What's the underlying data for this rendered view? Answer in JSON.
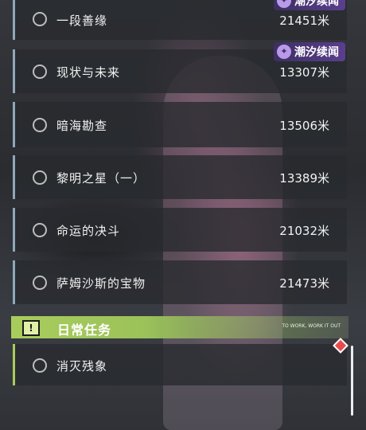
{
  "quests": [
    {
      "name": "一段善缘",
      "distance": "21451米",
      "badge": "潮汐续闻"
    },
    {
      "name": "现状与未来",
      "distance": "13307米",
      "badge": "潮汐续闻"
    },
    {
      "name": "暗海勘查",
      "distance": "13506米"
    },
    {
      "name": "黎明之星（一）",
      "distance": "13389米"
    },
    {
      "name": "命运的决斗",
      "distance": "21032米"
    },
    {
      "name": "萨姆沙斯的宝物",
      "distance": "21473米"
    }
  ],
  "section": {
    "title": "日常任务",
    "tagline": "TO WORK, WORK IT OUT",
    "alert_icon": "exclamation-icon",
    "color": "#a9cc5c"
  },
  "daily_quests": [
    {
      "name": "消灭残象"
    }
  ],
  "colors": {
    "badge": "#5a3f8d",
    "marker": "#e84b4b",
    "quest_border": "#8fa7b9"
  }
}
